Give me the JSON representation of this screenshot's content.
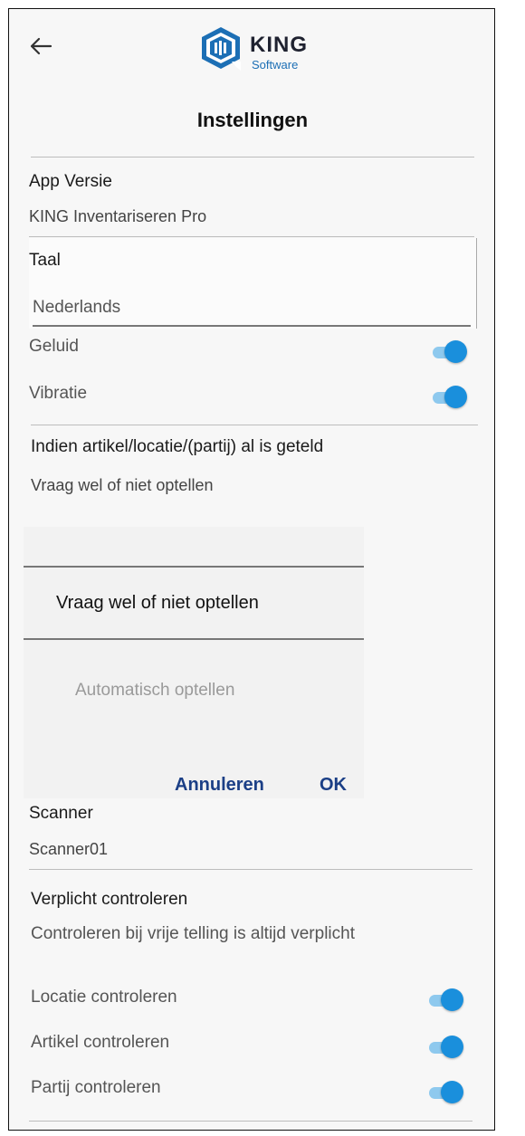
{
  "header": {
    "logo_text": "KING",
    "logo_sub": "Software",
    "title": "Instellingen"
  },
  "app_version": {
    "label": "App Versie",
    "value": "KING Inventariseren Pro"
  },
  "language": {
    "label": "Taal",
    "value": "Nederlands"
  },
  "toggles_top": [
    {
      "label": "Geluid",
      "on": true
    },
    {
      "label": "Vibratie",
      "on": true
    }
  ],
  "counted": {
    "label": "Indien artikel/locatie/(partij) al is geteld",
    "value": "Vraag wel of niet optellen"
  },
  "dialog": {
    "options": [
      "Vraag wel of niet optellen",
      "Automatisch optellen"
    ],
    "selected": "Vraag wel of niet optellen",
    "cancel_label": "Annuleren",
    "ok_label": "OK"
  },
  "scanner": {
    "label": "Scanner",
    "value": "Scanner01"
  },
  "mandatory": {
    "label": "Verplicht controleren",
    "note": "Controleren bij vrije telling is altijd verplicht"
  },
  "toggles_bottom": [
    {
      "label": "Locatie controleren",
      "on": true
    },
    {
      "label": "Artikel controleren",
      "on": true
    },
    {
      "label": "Partij controleren",
      "on": true
    }
  ],
  "colors": {
    "accent": "#1a8fdc",
    "accent_track": "#8ec9ee",
    "button_text": "#1b3f86",
    "brand_blue": "#1c6fb5"
  }
}
